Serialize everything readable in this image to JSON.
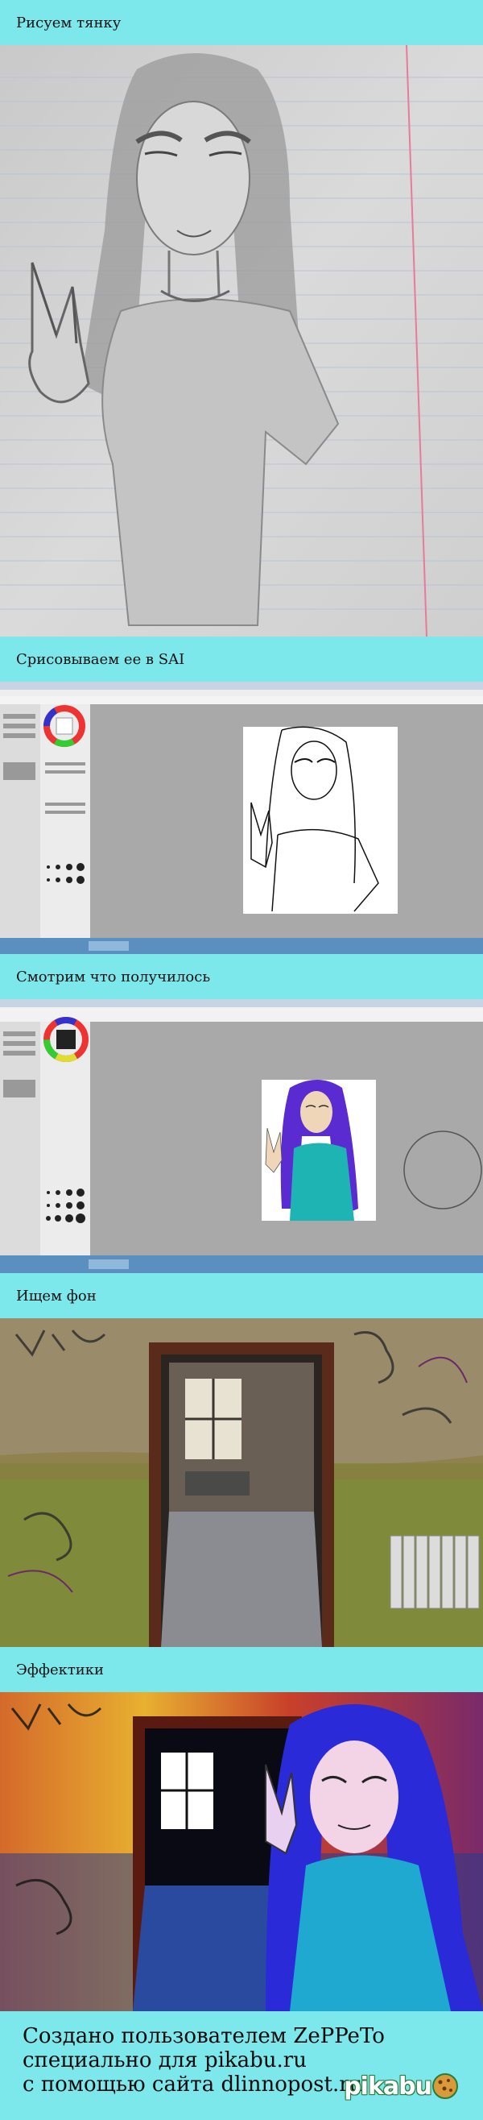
{
  "captions": {
    "step1": "Рисуем тянку",
    "step2": "Срисовываем ее в SAI",
    "step3": "Смотрим что получилось",
    "step4": "Ищем фон",
    "step5": "Эффектики"
  },
  "footer": {
    "line1": "Создано пользователем ZePPeTo",
    "line2": "специально для pikabu.ru",
    "line3": "с помощью сайта dlinnopost.ru"
  },
  "logo": {
    "text": "pikabu",
    "icon": "cookie-icon"
  },
  "colors": {
    "background": "#7de8ec",
    "paper": "#d6d6d6",
    "margin_line": "#e87a9a",
    "sai_canvas_bg": "#a9a9a9",
    "hair_purple": "#5a2bd0",
    "shirt_teal": "#1fb4b4",
    "logo_green": "#2a7c3a"
  }
}
